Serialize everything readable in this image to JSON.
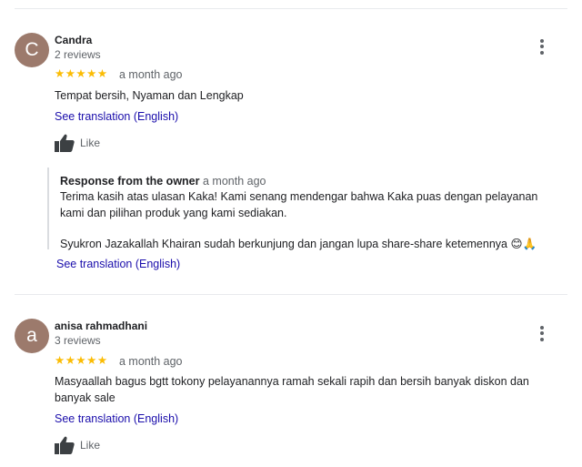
{
  "reviews": [
    {
      "avatar_letter": "C",
      "avatar_color": "#9c7a6c",
      "author": "Candra",
      "review_count": "2 reviews",
      "stars": "★★★★★",
      "rating": 5,
      "time": "a month ago",
      "text": "Tempat bersih, Nyaman dan Lengkap",
      "translate": "See translation (English)",
      "like": "Like",
      "owner_response": {
        "title": "Response from the owner",
        "time": "a month ago",
        "para1": "Terima kasih atas ulasan Kaka! Kami senang mendengar bahwa Kaka puas dengan pelayanan kami dan pilihan produk yang kami sediakan.",
        "para2": "Syukron Jazakallah Khairan sudah berkunjung dan jangan lupa share-share ketemennya 😊🙏",
        "translate": "See translation (English)"
      }
    },
    {
      "avatar_letter": "a",
      "avatar_color": "#9c7a6c",
      "author": "anisa rahmadhani",
      "review_count": "3 reviews",
      "stars": "★★★★★",
      "rating": 5,
      "time": "a month ago",
      "text": "Masyaallah bagus bgtt tokony pelayanannya ramah sekali rapih dan bersih banyak diskon dan banyak sale",
      "translate": "See translation (English)",
      "like": "Like"
    }
  ],
  "colors": {
    "star": "#fbbc04",
    "link": "#1a0dab",
    "secondary_text": "#5f6368"
  }
}
